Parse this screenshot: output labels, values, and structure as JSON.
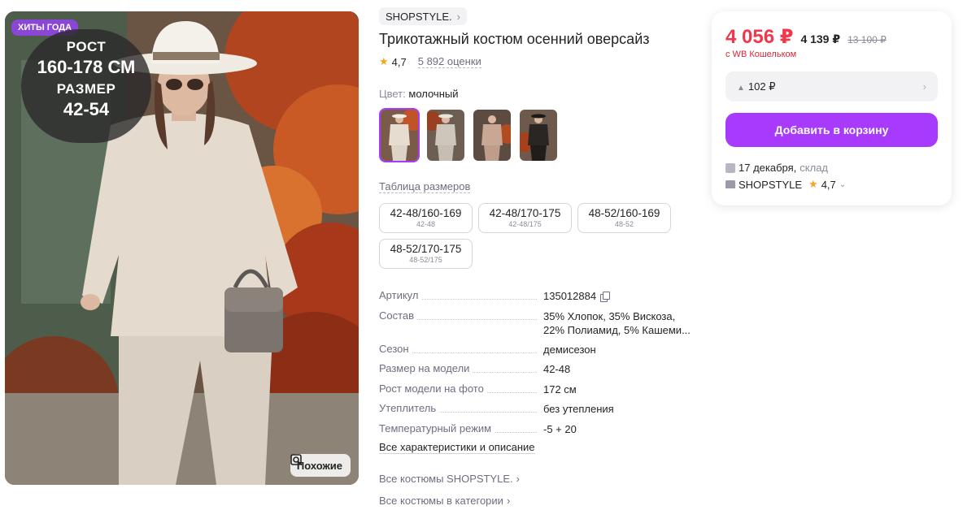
{
  "photo": {
    "badge": "ХИТЫ ГОДА",
    "promo": [
      "РОСТ",
      "160-178 СМ",
      "РАЗМЕР",
      "42-54"
    ],
    "similar_label": "Похожие"
  },
  "product": {
    "brand": "SHOPSTYLE.",
    "title": "Трикотажный костюм осенний оверсайз",
    "rating": "4,7",
    "reviews": "5 892 оценки"
  },
  "color": {
    "label": "Цвет:",
    "value": "молочный",
    "thumbnails": [
      {
        "color": "#e6dccf",
        "selected": true
      },
      {
        "color": "#cfc6bb",
        "selected": false
      },
      {
        "color": "#c9a795",
        "selected": false
      },
      {
        "color": "#2a2624",
        "selected": false
      }
    ]
  },
  "sizes": {
    "table_link": "Таблица размеров",
    "options": [
      {
        "main": "42-48/160-169",
        "sub": "42-48"
      },
      {
        "main": "42-48/170-175",
        "sub": "42-48/175"
      },
      {
        "main": "48-52/160-169",
        "sub": "48-52"
      },
      {
        "main": "48-52/170-175",
        "sub": "48-52/175"
      }
    ]
  },
  "specs": [
    {
      "key": "Артикул",
      "value": "135012884"
    },
    {
      "key": "Состав",
      "value": "35% Хлопок, 35% Вискоза, 22% Полиамид, 5% Кашеми..."
    },
    {
      "key": "Сезон",
      "value": "демисезон"
    },
    {
      "key": "Размер на модели",
      "value": "42-48"
    },
    {
      "key": "Рост модели на фото",
      "value": "172 см"
    },
    {
      "key": "Утеплитель",
      "value": "без утепления"
    },
    {
      "key": "Температурный режим",
      "value": "-5 + 20"
    }
  ],
  "links": {
    "all_specs": "Все характеристики и описание",
    "all_brand": "Все костюмы SHOPSTYLE.",
    "all_category": "Все костюмы в категории"
  },
  "card": {
    "price": "4 056 ₽",
    "price_alt": "4 139 ₽",
    "price_old": "13 100 ₽",
    "wallet_note": "с WB Кошельком",
    "bonus": "102 ₽",
    "cart_button": "Добавить в корзину",
    "delivery_date": "17 декабря,",
    "delivery_from": "склад",
    "seller": "SHOPSTYLE",
    "seller_rating": "4,7"
  },
  "colors": {
    "accent": "#a73afd",
    "price": "#f0374b",
    "badge": "#8a47d6"
  }
}
